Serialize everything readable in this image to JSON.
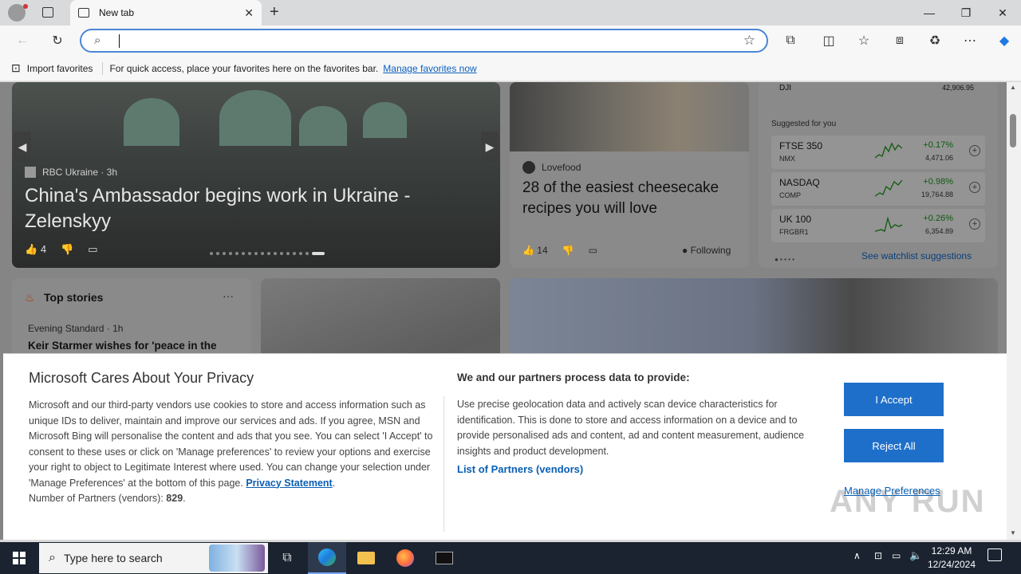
{
  "browser": {
    "tab_title": "New tab",
    "address_value": "",
    "favorites_bar": {
      "import_label": "Import favorites",
      "message": "For quick access, place your favorites here on the favorites bar.",
      "manage_link": "Manage favorites now"
    }
  },
  "feed": {
    "hero": {
      "source": "RBC Ukraine · 3h",
      "title": "China's Ambassador begins work in Ukraine - Zelenskyy",
      "likes": "4"
    },
    "food": {
      "source": "Lovefood",
      "title": "28 of the easiest cheesecake recipes you will love",
      "likes": "14",
      "following_label": "Following"
    },
    "stocks": {
      "top_symbol": "DJI",
      "top_value": "42,906.95",
      "suggested_label": "Suggested for you",
      "rows": [
        {
          "name": "FTSE 350",
          "exchange": "NMX",
          "change": "+0.17%",
          "value": "4,471.06"
        },
        {
          "name": "NASDAQ",
          "exchange": "COMP",
          "change": "+0.98%",
          "value": "19,764.88"
        },
        {
          "name": "UK 100",
          "exchange": "FRGBR1",
          "change": "+0.26%",
          "value": "6,354.89"
        }
      ],
      "watchlist_link": "See watchlist suggestions"
    },
    "top_stories": {
      "heading": "Top stories",
      "more": "···",
      "source": "Evening Standard · 1h",
      "title": "Keir Starmer wishes for 'peace in the"
    }
  },
  "privacy": {
    "title": "Microsoft Cares About Your Privacy",
    "body": "Microsoft and our third-party vendors use cookies to store and access information such as unique IDs to deliver, maintain and improve our services and ads. If you agree, MSN and Microsoft Bing will personalise the content and ads that you see. You can select 'I Accept' to consent to these uses or click on 'Manage preferences' to review your options and exercise your right to object to Legitimate Interest where used.  You can change your selection under 'Manage Preferences' at the bottom of this page.",
    "privacy_link": "Privacy Statement",
    "partners_prefix": "Number of Partners (vendors):",
    "partners_count": "829",
    "right_title": "We and our partners process data to provide:",
    "right_body": "Use precise geolocation data and actively scan device characteristics for identification. This is done to store and access information on a device and to provide personalised ads and content, ad and content measurement, audience insights and product development.",
    "list_partners": "List of Partners (vendors)",
    "accept": "I Accept",
    "reject": "Reject All",
    "manage": "Manage Preferences"
  },
  "watermark": "ANY RUN",
  "taskbar": {
    "search_placeholder": "Type here to search",
    "time": "12:29 AM",
    "date": "12/24/2024"
  },
  "colors": {
    "accent": "#1e6fc9",
    "link": "#0a5fb4",
    "positive": "#0f5a0f"
  }
}
